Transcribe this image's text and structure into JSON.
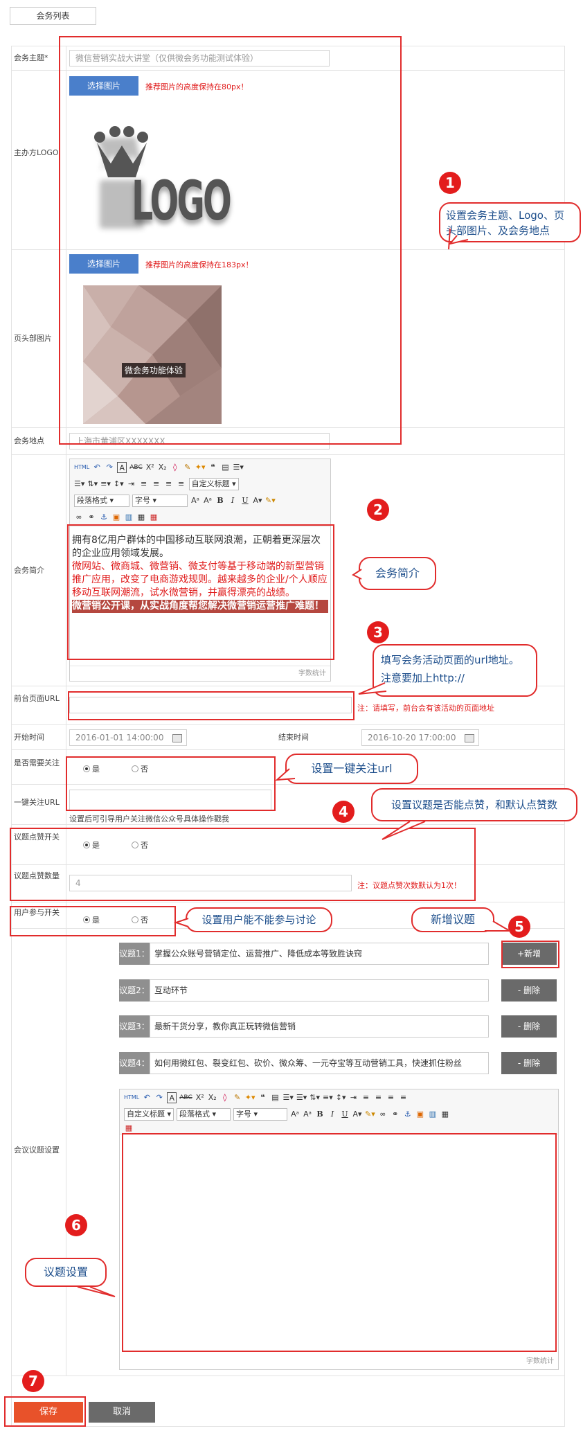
{
  "tab_label": "会务列表",
  "labels": {
    "topic": "会务主题*",
    "logo": "主办方LOGO",
    "header_image": "页头部图片",
    "location": "会务地点",
    "intro": "会务简介",
    "front_url": "前台页面URL",
    "start_time": "开始时间",
    "end_time": "结束时间",
    "need_follow": "是否需要关注",
    "follow_url": "一键关注URL",
    "like_switch": "议题点赞开关",
    "like_count": "议题点赞数量",
    "user_participate": "用户参与开关",
    "agenda": "会议议题设置"
  },
  "fields": {
    "topic_placeholder": "微信营销实战大讲堂（仅供微会务功能测试体验）",
    "choose_image": "选择图片",
    "logo_hint": "推荐图片的高度保持在80px！",
    "logo_text": "LOGO",
    "header_hint": "推荐图片的高度保持在183px！",
    "header_caption": "微会务功能体验",
    "location_placeholder": "上海市黄浦区XXXXXXX",
    "intro_line1": "拥有8亿用户群体的中国移动互联网浪潮，正朝着更深层次的企业应用领域发展。",
    "intro_line2": "微网站、微商城、微营销、微支付等基于移动端的新型营销推广应用，改变了电商游戏规则。越来越多的企业/个人顺应移动互联网潮流，试水微营销，并赢得漂亮的战绩。",
    "intro_line3": "微营销公开课，从实战角度帮您解决微营销运营推广难题！",
    "word_count": "字数统计",
    "url_note": "注：请填写，前台会有该活动的页面地址",
    "start_value": "2016-01-01 14:00:00",
    "end_value": "2016-10-20 17:00:00",
    "radio_yes": "是",
    "radio_no": "否",
    "follow_help": "设置后可引导用户关注微信公众号具体操作戳我",
    "like_count_value": "4",
    "like_note": "注：议题点赞次数默认为1次！",
    "add_btn": "+新增",
    "delete_btn": "- 删除"
  },
  "editor": {
    "font_style": "段落格式",
    "font_size": "字号",
    "custom_title": "自定义标题"
  },
  "topics": [
    {
      "label": "议题1：",
      "value": "掌握公众账号营销定位、运营推广、降低成本等致胜诀窍"
    },
    {
      "label": "议题2：",
      "value": "互动环节"
    },
    {
      "label": "议题3：",
      "value": "最新干货分享，教你真正玩转微信营销"
    },
    {
      "label": "议题4：",
      "value": "如何用微红包、裂变红包、砍价、微众筹、一元夺宝等互动营销工具，快速抓住粉丝"
    }
  ],
  "actions": {
    "save": "保存",
    "cancel": "取消"
  },
  "annotations": {
    "c1": "设置会务主题、Logo、页头部图片、及会务地点",
    "c2": "会务简介",
    "c3": "填写会务活动页面的url地址。注意要加上http://",
    "c_follow": "设置一键关注url",
    "c4": "设置议题是否能点赞，和默认点赞数",
    "c_user": "设置用户能不能参与讨论",
    "c5": "新增议题",
    "c6": "议题设置",
    "n1": "1",
    "n2": "2",
    "n3": "3",
    "n4": "4",
    "n5": "5",
    "n6": "6",
    "n7": "7"
  },
  "colors": {
    "accent_red": "#e12c2c",
    "save_btn": "#e8522a",
    "choose_btn": "#4a7fcb",
    "callout_text": "#1e4f8c"
  }
}
